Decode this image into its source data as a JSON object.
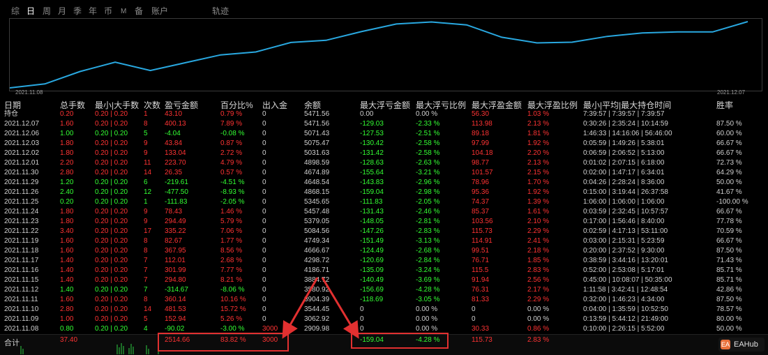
{
  "tabs": [
    {
      "label": "综",
      "active": false
    },
    {
      "label": "日",
      "active": true
    },
    {
      "label": "周",
      "active": false
    },
    {
      "label": "月",
      "active": false
    },
    {
      "label": "季",
      "active": false
    },
    {
      "label": "年",
      "active": false
    },
    {
      "label": "币",
      "active": false
    },
    {
      "label": "M",
      "active": false
    },
    {
      "label": "备",
      "active": false
    },
    {
      "label": "账户",
      "active": false
    },
    {
      "label": "轨迹",
      "active": false
    }
  ],
  "chart": {
    "start_date": "2021.11.08",
    "end_date": "2021.12.07",
    "line_color": "#29a8e0",
    "balance_series": [
      2909.98,
      3062.92,
      3544.45,
      3904.39,
      3580.92,
      3884.72,
      4186.71,
      4298.72,
      4666.67,
      4749.34,
      5084.56,
      5379.05,
      5457.48,
      5345.65,
      4868.15,
      4648.54,
      4674.89,
      4898.59,
      5031.63,
      5075.47,
      5071.43,
      5471.56
    ]
  },
  "table": {
    "headers": [
      "日期",
      "总手数",
      "最小|大手数",
      "次数",
      "盈亏金额",
      "百分比%",
      "出入金",
      "余额",
      "最大浮亏金额",
      "最大浮亏比例",
      "最大浮盈金额",
      "最大浮盈比例",
      "最小|平均|最大持仓时间",
      "胜率"
    ],
    "rows": [
      {
        "date": "持仓",
        "lots": "0.20",
        "minmax": "0.20 | 0.20",
        "count": "1",
        "pnl": "43.10",
        "pct": "0.79 %",
        "flow": "0",
        "balance": "5471.56",
        "max_dd": "0.00",
        "max_dd_pct": "0.00 %",
        "max_fp": "56.30",
        "max_fp_pct": "1.03 %",
        "hold": "7:39:57 | 7:39:57 | 7:39:57",
        "win": "",
        "color": "red",
        "ddc": "gray"
      },
      {
        "date": "2021.12.07",
        "lots": "1.60",
        "minmax": "0.20 | 0.20",
        "count": "8",
        "pnl": "400.13",
        "pct": "7.89 %",
        "flow": "0",
        "balance": "5471.56",
        "max_dd": "-129.03",
        "max_dd_pct": "-2.33 %",
        "max_fp": "113.98",
        "max_fp_pct": "2.13 %",
        "hold": "0:30:26 | 2:35:24 | 10:14:59",
        "win": "87.50 %",
        "color": "red",
        "ddc": "green"
      },
      {
        "date": "2021.12.06",
        "lots": "1.00",
        "minmax": "0.20 | 0.20",
        "count": "5",
        "pnl": "-4.04",
        "pct": "-0.08 %",
        "flow": "0",
        "balance": "5071.43",
        "max_dd": "-127.53",
        "max_dd_pct": "-2.51 %",
        "max_fp": "89.18",
        "max_fp_pct": "1.81 %",
        "hold": "1:46:33 | 14:16:06 | 56:46:00",
        "win": "60.00 %",
        "color": "green",
        "ddc": "green"
      },
      {
        "date": "2021.12.03",
        "lots": "1.80",
        "minmax": "0.20 | 0.20",
        "count": "9",
        "pnl": "43.84",
        "pct": "0.87 %",
        "flow": "0",
        "balance": "5075.47",
        "max_dd": "-130.42",
        "max_dd_pct": "-2.58 %",
        "max_fp": "97.99",
        "max_fp_pct": "1.92 %",
        "hold": "0:05:59 | 1:49:26 | 5:38:01",
        "win": "66.67 %",
        "color": "red",
        "ddc": "green"
      },
      {
        "date": "2021.12.02",
        "lots": "1.80",
        "minmax": "0.20 | 0.20",
        "count": "9",
        "pnl": "133.04",
        "pct": "2.72 %",
        "flow": "0",
        "balance": "5031.63",
        "max_dd": "-131.42",
        "max_dd_pct": "-2.58 %",
        "max_fp": "104.18",
        "max_fp_pct": "2.20 %",
        "hold": "0:06:59 | 2:06:52 | 5:13:00",
        "win": "66.67 %",
        "color": "red",
        "ddc": "green"
      },
      {
        "date": "2021.12.01",
        "lots": "2.20",
        "minmax": "0.20 | 0.20",
        "count": "11",
        "pnl": "223.70",
        "pct": "4.79 %",
        "flow": "0",
        "balance": "4898.59",
        "max_dd": "-128.63",
        "max_dd_pct": "-2.63 %",
        "max_fp": "98.77",
        "max_fp_pct": "2.13 %",
        "hold": "0:01:02 | 2:07:15 | 6:18:00",
        "win": "72.73 %",
        "color": "red",
        "ddc": "green"
      },
      {
        "date": "2021.11.30",
        "lots": "2.80",
        "minmax": "0.20 | 0.20",
        "count": "14",
        "pnl": "26.35",
        "pct": "0.57 %",
        "flow": "0",
        "balance": "4674.89",
        "max_dd": "-155.64",
        "max_dd_pct": "-3.21 %",
        "max_fp": "101.57",
        "max_fp_pct": "2.15 %",
        "hold": "0:02:00 | 1:47:17 | 6:34:01",
        "win": "64.29 %",
        "color": "red",
        "ddc": "green"
      },
      {
        "date": "2021.11.29",
        "lots": "1.20",
        "minmax": "0.20 | 0.20",
        "count": "6",
        "pnl": "-219.61",
        "pct": "-4.51 %",
        "flow": "0",
        "balance": "4648.54",
        "max_dd": "-143.83",
        "max_dd_pct": "-2.96 %",
        "max_fp": "78.96",
        "max_fp_pct": "1.70 %",
        "hold": "0:04:26 | 2:28:24 | 8:36:00",
        "win": "50.00 %",
        "color": "green",
        "ddc": "green"
      },
      {
        "date": "2021.11.26",
        "lots": "2.40",
        "minmax": "0.20 | 0.20",
        "count": "12",
        "pnl": "-477.50",
        "pct": "-8.93 %",
        "flow": "0",
        "balance": "4868.15",
        "max_dd": "-159.04",
        "max_dd_pct": "-2.98 %",
        "max_fp": "95.36",
        "max_fp_pct": "1.92 %",
        "hold": "0:15:00 | 3:19:44 | 26:37:58",
        "win": "41.67 %",
        "color": "green",
        "ddc": "green"
      },
      {
        "date": "2021.11.25",
        "lots": "0.20",
        "minmax": "0.20 | 0.20",
        "count": "1",
        "pnl": "-111.83",
        "pct": "-2.05 %",
        "flow": "0",
        "balance": "5345.65",
        "max_dd": "-111.83",
        "max_dd_pct": "-2.05 %",
        "max_fp": "74.37",
        "max_fp_pct": "1.39 %",
        "hold": "1:06:00 | 1:06:00 | 1:06:00",
        "win": "-100.00 %",
        "color": "green",
        "ddc": "green"
      },
      {
        "date": "2021.11.24",
        "lots": "1.80",
        "minmax": "0.20 | 0.20",
        "count": "9",
        "pnl": "78.43",
        "pct": "1.46 %",
        "flow": "0",
        "balance": "5457.48",
        "max_dd": "-131.43",
        "max_dd_pct": "-2.46 %",
        "max_fp": "85.37",
        "max_fp_pct": "1.61 %",
        "hold": "0:03:59 | 2:32:45 | 10:57:57",
        "win": "66.67 %",
        "color": "red",
        "ddc": "green"
      },
      {
        "date": "2021.11.23",
        "lots": "1.80",
        "minmax": "0.20 | 0.20",
        "count": "9",
        "pnl": "294.49",
        "pct": "5.79 %",
        "flow": "0",
        "balance": "5379.05",
        "max_dd": "-148.05",
        "max_dd_pct": "-2.81 %",
        "max_fp": "103.56",
        "max_fp_pct": "2.10 %",
        "hold": "0:17:00 | 1:56:46 | 8:40:00",
        "win": "77.78 %",
        "color": "red",
        "ddc": "green"
      },
      {
        "date": "2021.11.22",
        "lots": "3.40",
        "minmax": "0.20 | 0.20",
        "count": "17",
        "pnl": "335.22",
        "pct": "7.06 %",
        "flow": "0",
        "balance": "5084.56",
        "max_dd": "-147.26",
        "max_dd_pct": "-2.83 %",
        "max_fp": "115.73",
        "max_fp_pct": "2.29 %",
        "hold": "0:02:59 | 4:17:13 | 53:11:00",
        "win": "70.59 %",
        "color": "red",
        "ddc": "green"
      },
      {
        "date": "2021.11.19",
        "lots": "1.60",
        "minmax": "0.20 | 0.20",
        "count": "8",
        "pnl": "82.67",
        "pct": "1.77 %",
        "flow": "0",
        "balance": "4749.34",
        "max_dd": "-151.49",
        "max_dd_pct": "-3.13 %",
        "max_fp": "114.91",
        "max_fp_pct": "2.41 %",
        "hold": "0:03:00 | 2:15:31 | 5:23:59",
        "win": "66.67 %",
        "color": "red",
        "ddc": "green"
      },
      {
        "date": "2021.11.18",
        "lots": "1.60",
        "minmax": "0.20 | 0.20",
        "count": "8",
        "pnl": "367.95",
        "pct": "8.56 %",
        "flow": "0",
        "balance": "4666.67",
        "max_dd": "-124.49",
        "max_dd_pct": "-2.68 %",
        "max_fp": "99.51",
        "max_fp_pct": "2.18 %",
        "hold": "0:20:00 | 2:37:52 | 9:30:00",
        "win": "87.50 %",
        "color": "red",
        "ddc": "green"
      },
      {
        "date": "2021.11.17",
        "lots": "1.40",
        "minmax": "0.20 | 0.20",
        "count": "7",
        "pnl": "112.01",
        "pct": "2.68 %",
        "flow": "0",
        "balance": "4298.72",
        "max_dd": "-120.69",
        "max_dd_pct": "-2.84 %",
        "max_fp": "76.71",
        "max_fp_pct": "1.85 %",
        "hold": "0:38:59 | 3:44:16 | 13:20:01",
        "win": "71.43 %",
        "color": "red",
        "ddc": "green"
      },
      {
        "date": "2021.11.16",
        "lots": "1.40",
        "minmax": "0.20 | 0.20",
        "count": "7",
        "pnl": "301.99",
        "pct": "7.77 %",
        "flow": "0",
        "balance": "4186.71",
        "max_dd": "-135.09",
        "max_dd_pct": "-3.24 %",
        "max_fp": "115.5",
        "max_fp_pct": "2.83 %",
        "hold": "0:52:00 | 2:53:08 | 5:17:01",
        "win": "85.71 %",
        "color": "red",
        "ddc": "green"
      },
      {
        "date": "2021.11.15",
        "lots": "1.40",
        "minmax": "0.20 | 0.20",
        "count": "7",
        "pnl": "294.80",
        "pct": "8.21 %",
        "flow": "0",
        "balance": "3884.72",
        "max_dd": "-140.49",
        "max_dd_pct": "-3.69 %",
        "max_fp": "91.94",
        "max_fp_pct": "2.56 %",
        "hold": "0:45:00 | 10:08:07 | 50:35:00",
        "win": "85.71 %",
        "color": "red",
        "ddc": "green"
      },
      {
        "date": "2021.11.12",
        "lots": "1.40",
        "minmax": "0.20 | 0.20",
        "count": "7",
        "pnl": "-314.67",
        "pct": "-8.06 %",
        "flow": "0",
        "balance": "3580.92",
        "max_dd": "-156.69",
        "max_dd_pct": "-4.28 %",
        "max_fp": "76.31",
        "max_fp_pct": "2.17 %",
        "hold": "1:11:58 | 3:42:41 | 12:48:54",
        "win": "42.86 %",
        "color": "green",
        "ddc": "green"
      },
      {
        "date": "2021.11.11",
        "lots": "1.60",
        "minmax": "0.20 | 0.20",
        "count": "8",
        "pnl": "360.14",
        "pct": "10.16 %",
        "flow": "0",
        "balance": "3904.39",
        "max_dd": "-118.69",
        "max_dd_pct": "-3.05 %",
        "max_fp": "81.33",
        "max_fp_pct": "2.29 %",
        "hold": "0:32:00 | 1:46:23 | 4:34:00",
        "win": "87.50 %",
        "color": "red",
        "ddc": "green"
      },
      {
        "date": "2021.11.10",
        "lots": "2.80",
        "minmax": "0.20 | 0.20",
        "count": "14",
        "pnl": "481.53",
        "pct": "15.72 %",
        "flow": "0",
        "balance": "3544.45",
        "max_dd": "0",
        "max_dd_pct": "0.00 %",
        "max_fp": "0",
        "max_fp_pct": "0.00 %",
        "hold": "0:04:00 | 1:35:59 | 10:52:50",
        "win": "78.57 %",
        "color": "red",
        "ddc": "gray"
      },
      {
        "date": "2021.11.09",
        "lots": "1.00",
        "minmax": "0.20 | 0.20",
        "count": "5",
        "pnl": "152.94",
        "pct": "5.26 %",
        "flow": "0",
        "balance": "3062.92",
        "max_dd": "0",
        "max_dd_pct": "0.00 %",
        "max_fp": "0",
        "max_fp_pct": "0.00 %",
        "hold": "0:13:59 | 5:44:12 | 21:49:00",
        "win": "80.00 %",
        "color": "red",
        "ddc": "gray"
      },
      {
        "date": "2021.11.08",
        "lots": "0.80",
        "minmax": "0.20 | 0.20",
        "count": "4",
        "pnl": "-90.02",
        "pct": "-3.00 %",
        "flow": "3000",
        "balance": "2909.98",
        "max_dd": "0",
        "max_dd_pct": "0.00 %",
        "max_fp": "30.33",
        "max_fp_pct": "0.86 %",
        "hold": "0:10:00 | 2:26:15 | 5:52:00",
        "win": "50.00 %",
        "color": "green",
        "ddc": "gray"
      }
    ],
    "total": {
      "label": "合计",
      "lots": "37.40",
      "pnl": "2514.66",
      "pct": "83.82 %",
      "flow": "3000",
      "max_dd": "-159.04",
      "max_dd_pct": "-4.28 %",
      "max_fp": "115.73",
      "max_fp_pct": "2.83 %"
    }
  },
  "logo": {
    "mark": "EA",
    "text": "EAHub"
  },
  "colors": {
    "profit": "#ff3333",
    "loss": "#33ff33",
    "highlight": "#e23030",
    "line": "#29a8e0"
  }
}
